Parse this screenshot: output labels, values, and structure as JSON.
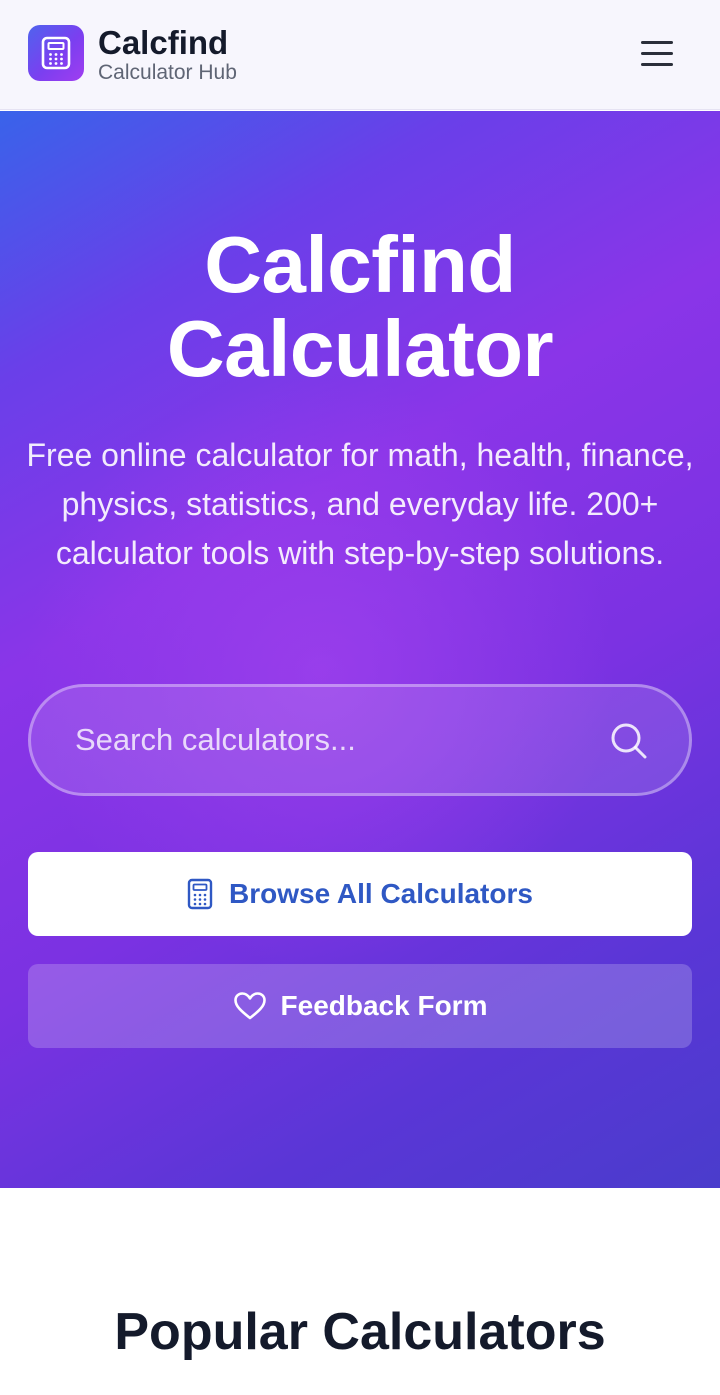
{
  "header": {
    "brand_title": "Calcfind",
    "brand_subtitle": "Calculator Hub",
    "logo_icon": "calculator-icon",
    "menu_icon": "hamburger-menu-icon"
  },
  "hero": {
    "title_line1": "Calcfind",
    "title_line2": "Calculator",
    "description": "Free online calculator for math, health, finance, physics, statistics, and everyday life. 200+ calculator tools with step-by-step solutions.",
    "search": {
      "placeholder": "Search calculators...",
      "value": "",
      "icon": "search-icon"
    },
    "browse_button": {
      "label": "Browse All Calculators",
      "icon": "calculator-icon"
    },
    "feedback_button": {
      "label": "Feedback Form",
      "icon": "heart-icon"
    }
  },
  "popular": {
    "title": "Popular Calculators"
  },
  "colors": {
    "accent_blue": "#2f58c4",
    "gradient_start": "#3963ea",
    "gradient_mid": "#8a35e8",
    "gradient_end": "#4a3ccc",
    "heading_dark": "#141a2b"
  }
}
